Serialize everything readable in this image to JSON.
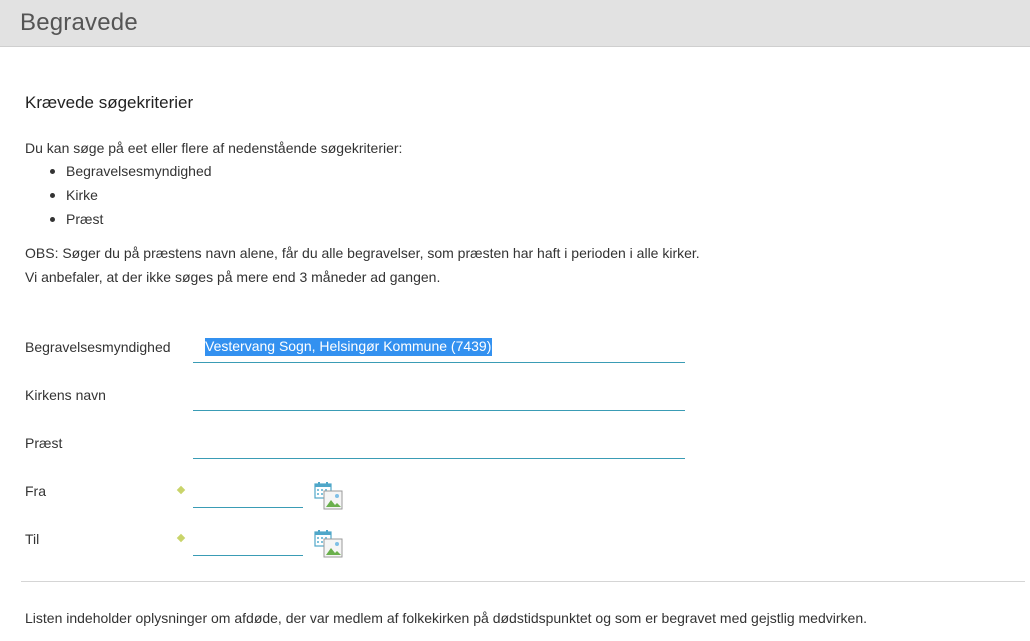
{
  "header": {
    "title": "Begravede"
  },
  "section": {
    "heading": "Krævede søgekriterier",
    "intro": "Du kan søge på eet eller flere af nedenstående søgekriterier:",
    "criteria": [
      "Begravelsesmyndighed",
      "Kirke",
      "Præst"
    ],
    "obs_line1": "OBS: Søger du på præstens navn alene, får du alle begravelser, som præsten har haft i perioden i alle kirker.",
    "obs_line2": "Vi anbefaler, at der ikke søges på mere end 3 måneder ad gangen."
  },
  "form": {
    "authority": {
      "label": "Begravelsesmyndighed",
      "value": "Vestervang Sogn, Helsingør Kommune (7439)"
    },
    "church": {
      "label": "Kirkens navn",
      "value": ""
    },
    "priest": {
      "label": "Præst",
      "value": ""
    },
    "from": {
      "label": "Fra",
      "value": ""
    },
    "to": {
      "label": "Til",
      "value": ""
    },
    "calendar_icon": "calendar-icon"
  },
  "footer": {
    "note": "Listen indeholder oplysninger om afdøde, der var medlem af folkekirken på dødstidspunktet og som er begravet med gejstlig medvirken."
  },
  "colors": {
    "header_bg": "#e2e2e2",
    "field_underline": "#3a9cb5",
    "selection": "#3391f0",
    "required_marker": "#c9d46a"
  }
}
